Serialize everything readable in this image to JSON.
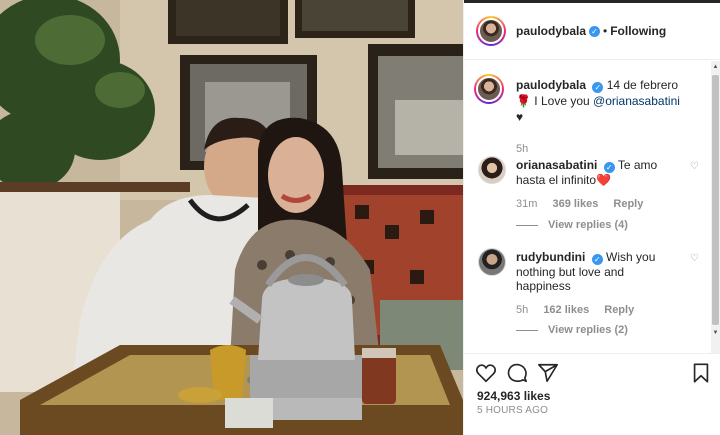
{
  "post": {
    "author": "paulodybala",
    "header_separator": "•",
    "follow_state": "Following",
    "caption": {
      "username": "paulodybala",
      "date": "14 de febrero",
      "emoji_rose": "🌹",
      "text": "I Love you",
      "mention": "@orianasabatini",
      "emoji_heart": "♥",
      "time": "5h"
    },
    "comments": [
      {
        "username": "orianasabatini",
        "text": "Te amo hasta el infinito",
        "emoji": "❤️",
        "time": "31m",
        "likes": "369 likes",
        "reply": "Reply",
        "view_replies": "View replies (4)"
      },
      {
        "username": "rudybundini",
        "text": "Wish you nothing but love and happiness",
        "time": "5h",
        "likes": "162 likes",
        "reply": "Reply",
        "view_replies": "View replies (2)"
      }
    ],
    "likes_count": "924,963 likes",
    "posted_ago": "5 HOURS AGO"
  },
  "icons": {
    "verified": "verified-badge-icon",
    "like": "heart-icon",
    "comment": "comment-icon",
    "share": "share-icon",
    "save": "bookmark-icon"
  },
  "colors": {
    "verified_blue": "#3897f0",
    "text": "#262626",
    "secondary": "#8e8e8e",
    "mention": "#00376b"
  }
}
